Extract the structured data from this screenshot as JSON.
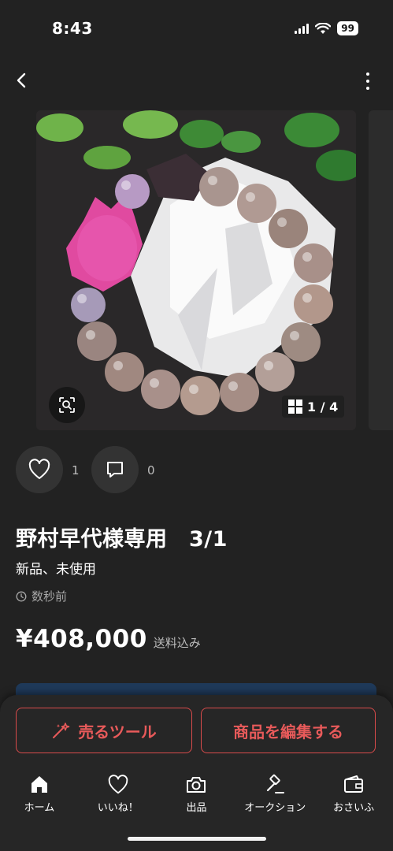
{
  "status_bar": {
    "time": "8:43",
    "battery": "99"
  },
  "gallery": {
    "counter": "1 / 4"
  },
  "actions": {
    "like_count": "1",
    "comment_count": "0"
  },
  "item": {
    "title": "野村早代様専用　3/1",
    "condition": "新品、未使用",
    "posted": "数秒前",
    "price": "¥408,000",
    "shipping": "送料込み"
  },
  "buttons": {
    "sell_tool": "売るツール",
    "edit_item": "商品を編集する"
  },
  "tabbar": [
    {
      "label": "ホーム",
      "icon": "home-icon"
    },
    {
      "label": "いいね！",
      "icon": "heart-icon"
    },
    {
      "label": "出品",
      "icon": "camera-icon"
    },
    {
      "label": "オークション",
      "icon": "gavel-icon"
    },
    {
      "label": "おさいふ",
      "icon": "wallet-icon"
    }
  ],
  "colors": {
    "accent": "#e85a5a",
    "background": "#222222"
  }
}
